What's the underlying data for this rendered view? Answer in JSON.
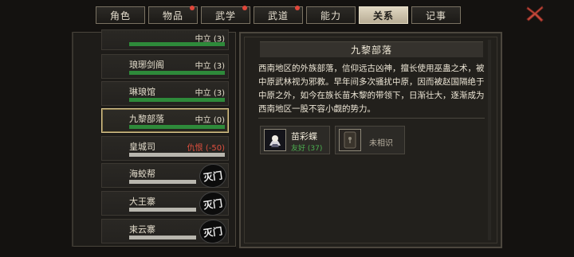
{
  "tabs": [
    {
      "label": "角色",
      "dot": false,
      "active": false
    },
    {
      "label": "物品",
      "dot": true,
      "active": false
    },
    {
      "label": "武学",
      "dot": true,
      "active": false
    },
    {
      "label": "武道",
      "dot": true,
      "active": false
    },
    {
      "label": "能力",
      "dot": false,
      "active": false
    },
    {
      "label": "关系",
      "dot": false,
      "active": true
    },
    {
      "label": "记事",
      "dot": false,
      "active": false
    }
  ],
  "sects": [
    {
      "name": "",
      "relation": "中立 (3)",
      "fill": 1.0,
      "bar": "green",
      "stamp": ""
    },
    {
      "name": "琅琊剑阁",
      "relation": "中立 (3)",
      "fill": 1.0,
      "bar": "green",
      "stamp": ""
    },
    {
      "name": "琳琅馆",
      "relation": "中立 (3)",
      "fill": 1.0,
      "bar": "green",
      "stamp": ""
    },
    {
      "name": "九黎部落",
      "relation": "中立 (0)",
      "fill": 1.0,
      "bar": "green",
      "stamp": "",
      "selected": true
    },
    {
      "name": "皇城司",
      "relation": "仇恨 (-50)",
      "fill": 1.0,
      "bar": "grey",
      "stamp": "",
      "hostile": true
    },
    {
      "name": "海蛟帮",
      "relation": "",
      "fill": 1.0,
      "bar": "grey",
      "stamp": "灭门"
    },
    {
      "name": "大王寨",
      "relation": "",
      "fill": 1.0,
      "bar": "grey",
      "stamp": "灭门"
    },
    {
      "name": "束云寨",
      "relation": "",
      "fill": 1.0,
      "bar": "grey",
      "stamp": "灭门"
    }
  ],
  "detail": {
    "title": "九黎部落",
    "description": "西南地区的外族部落，信仰远古凶神，擅长使用巫蛊之术，被中原武林视为邪教。早年间多次骚扰中原，因而被赵国隔绝于中原之外，如今在族长苗木黎的带领下，日渐壮大，逐渐成为西南地区一股不容小觑的势力。",
    "members": [
      {
        "name": "苗彩蝶",
        "status": "友好 (37)",
        "known": true
      },
      {
        "name": "",
        "status": "未相识",
        "known": false
      }
    ]
  },
  "colors": {
    "accent": "#d8c48e",
    "friendly": "#4caf50",
    "hostile": "#e0503f",
    "bar_green": "#2e8a3a"
  }
}
